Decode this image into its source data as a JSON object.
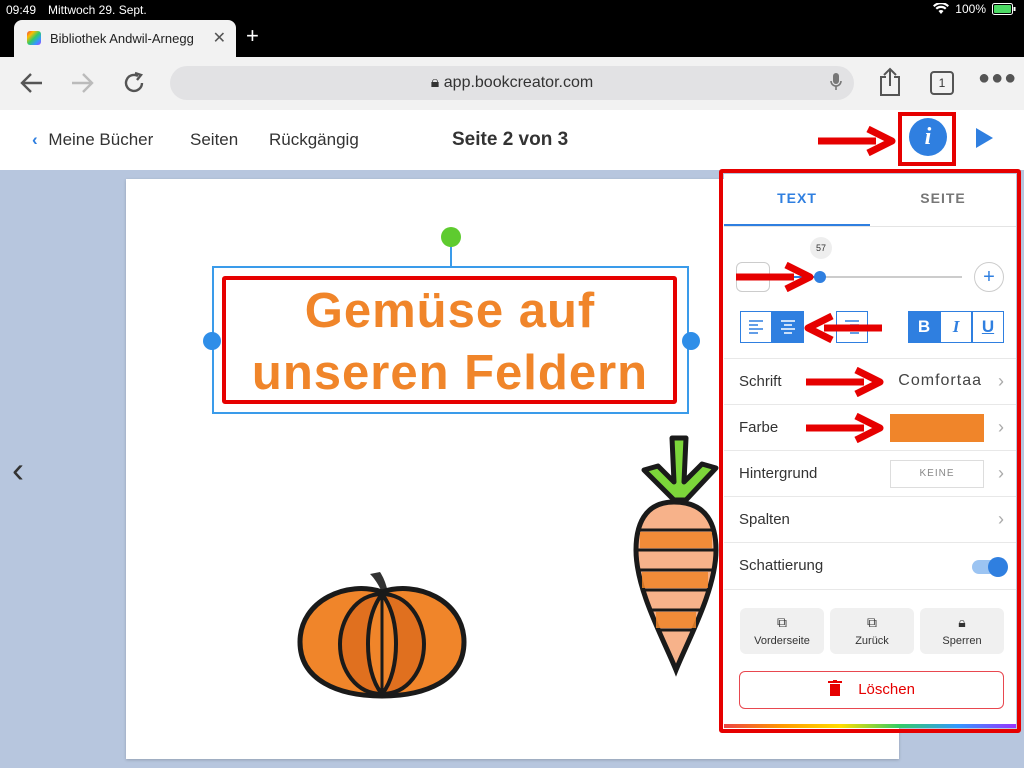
{
  "status": {
    "time": "09:49",
    "date": "Mittwoch 29. Sept.",
    "battery": "100%"
  },
  "browser": {
    "tab_title": "Bibliothek Andwil-Arnegg",
    "tab_close": "✕",
    "new_tab": "+",
    "url": "app.bookcreator.com",
    "tab_count": "1"
  },
  "toolbar": {
    "back_label": "Meine Bücher",
    "pages_label": "Seiten",
    "undo_label": "Rückgängig",
    "page_indicator": "Seite 2 von 3",
    "info_label": "i"
  },
  "canvas": {
    "title_line1": "Gemüse auf",
    "title_line2": "unseren Feldern"
  },
  "panel": {
    "tabs": [
      "TEXT",
      "SEITE"
    ],
    "font_size": "57",
    "font_size_fraction": 0.57,
    "bold": "B",
    "italic": "I",
    "underline": "U",
    "rows": {
      "font_label": "Schrift",
      "font_value": "Comfortaa",
      "color_label": "Farbe",
      "color_value": "#f0852a",
      "background_label": "Hintergrund",
      "background_value": "KEINE",
      "columns_label": "Spalten",
      "shadow_label": "Schattierung"
    },
    "actions": [
      "Vorderseite",
      "Zurück",
      "Sperren"
    ],
    "delete_label": "Löschen"
  },
  "colors": {
    "accent": "#2f7fe0",
    "highlight": "#e60000",
    "title_orange": "#f0852a"
  }
}
